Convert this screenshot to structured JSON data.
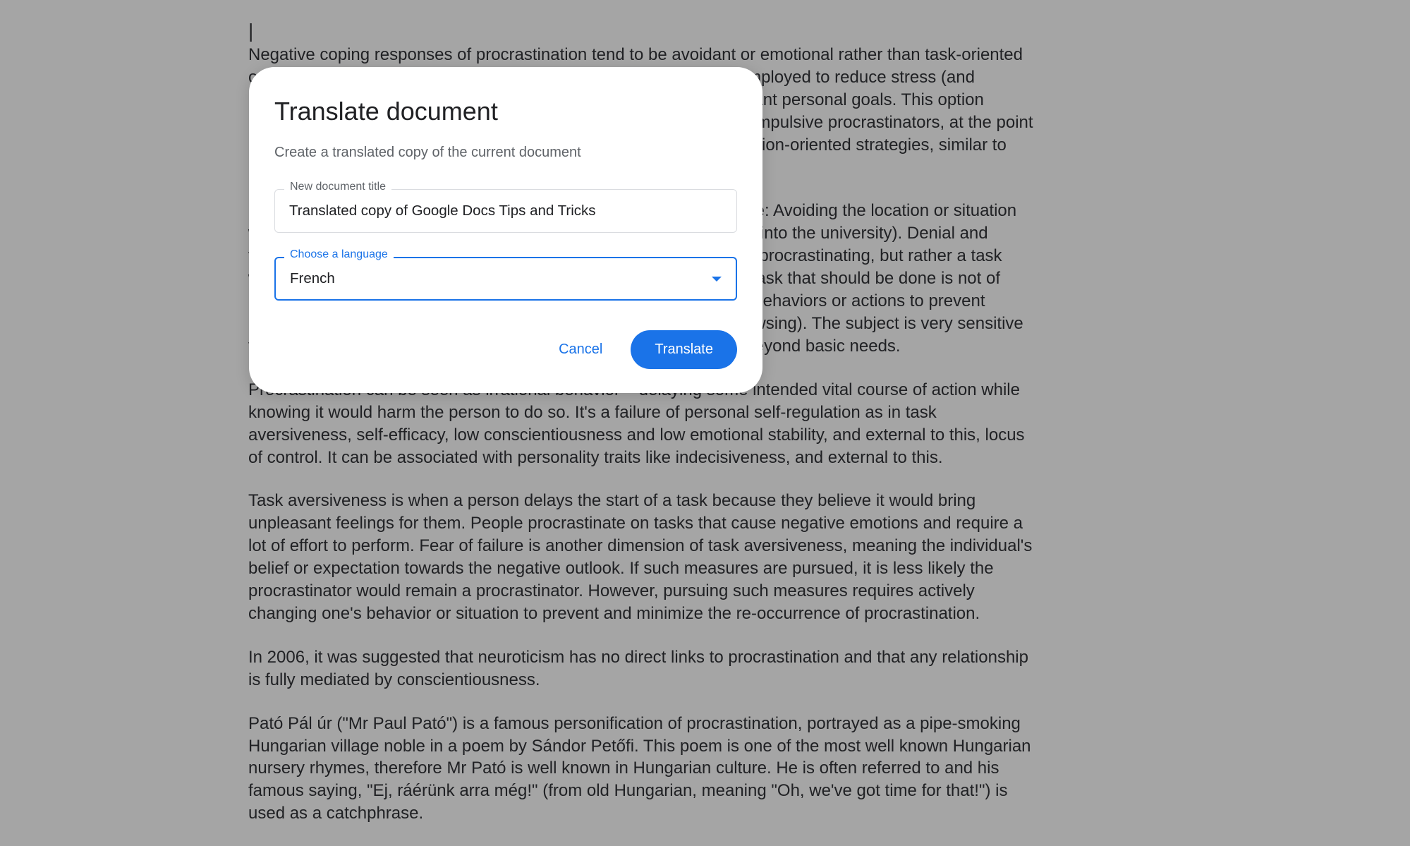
{
  "background_document": {
    "cursor_line": "|",
    "paragraphs": [
      "Negative coping responses of procrastination tend to be avoidant or emotional rather than task-oriented or focused on problem-solving. Emotional and avoidant coping is employed to reduce stress (and cognitive dissonance) associated with delaying intended and important personal goals. This option provides immediate pleasure and is consequently very attractive to impulsive procrastinators, at the point of discovery of the achievable goals at hand. There are several emotion-oriented strategies, similar to Freudian defense mechanisms, coping styles and self-handicapping.",
      "Coping responses of procrastinators include the following. Avoidance: Avoiding the location or situation where the task takes place (e.g. a graduate student avoiding driving into the university). Denial and trivialization: Pretending that procrastinatory behavior is not actually procrastinating, but rather a task which is more important than the avoided one, or that the essential task that should be done is not of immediate importance. Distraction: Engaging or immersing in other behaviors or actions to prevent awareness of the task (e.g. intensive videogame playing or web browsing). The subject is very sensitive to instant gratification and becomes absorbed in coping behaviors beyond basic needs.",
      "Procrastination can be seen as irrational behavior – delaying some intended vital course of action while knowing it would harm the person to do so. It's a failure of personal self-regulation as in task aversiveness, self-efficacy, low conscientiousness and low emotional stability, and external to this, locus of control. It can be associated with personality traits like indecisiveness, and external to this.",
      "Task aversiveness is when a person delays the start of a task because they believe it would bring unpleasant feelings for them. People procrastinate on tasks that cause negative emotions and require a lot of effort to perform. Fear of failure is another dimension of task aversiveness, meaning the individual's belief or expectation towards the negative outlook. If such measures are pursued, it is less likely the procrastinator would remain a procrastinator. However, pursuing such measures requires actively changing one's behavior or situation to prevent and minimize the re-occurrence of procrastination.",
      "In 2006, it was suggested that neuroticism has no direct links to procrastination and that any relationship is fully mediated by conscientiousness.",
      "Pató Pál úr (\"Mr Paul Pató\") is a famous personification of procrastination, portrayed as a pipe-smoking Hungarian village noble in a poem by Sándor Petőfi. This poem is one of the most well known Hungarian nursery rhymes, therefore Mr Pató is well known in Hungarian culture. He is often referred to and his famous saying, \"Ej, ráérünk arra még!\" (from old Hungarian, meaning \"Oh, we've got time for that!\") is used as a catchphrase."
    ]
  },
  "dialog": {
    "title": "Translate document",
    "subtitle": "Create a translated copy of the current document",
    "title_field": {
      "label": "New document title",
      "value": "Translated copy of Google Docs Tips and Tricks"
    },
    "language_field": {
      "label": "Choose a language",
      "value": "French"
    },
    "actions": {
      "cancel": "Cancel",
      "translate": "Translate"
    }
  }
}
